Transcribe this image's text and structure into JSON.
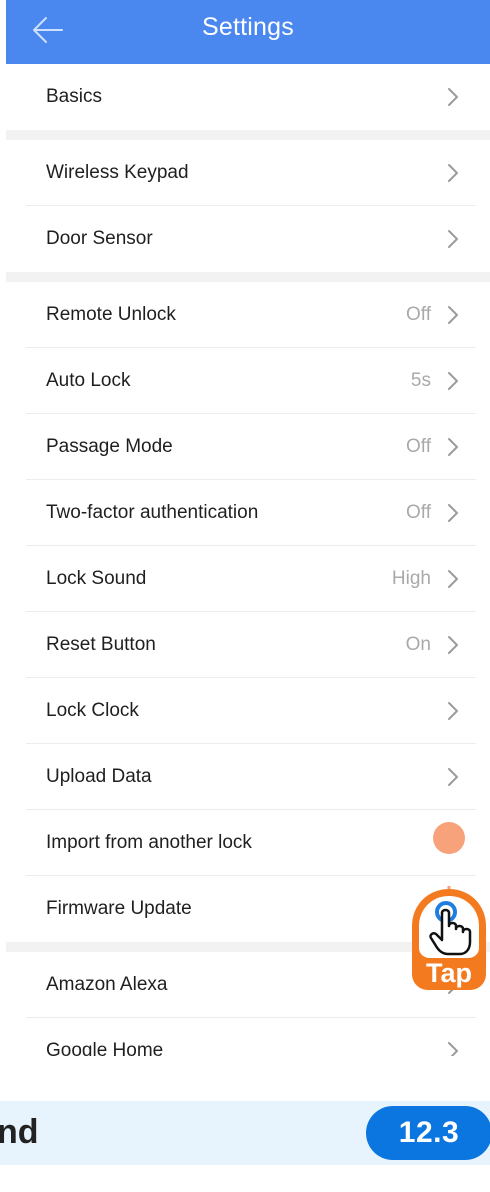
{
  "header": {
    "title": "Settings",
    "back_icon": "arrow-left-icon"
  },
  "groups": [
    [
      {
        "label": "Basics",
        "value": ""
      }
    ],
    [
      {
        "label": "Wireless Keypad",
        "value": ""
      },
      {
        "label": "Door Sensor",
        "value": ""
      }
    ],
    [
      {
        "label": "Remote Unlock",
        "value": "Off"
      },
      {
        "label": "Auto Lock",
        "value": "5s"
      },
      {
        "label": "Passage Mode",
        "value": "Off"
      },
      {
        "label": "Two-factor authentication",
        "value": "Off"
      },
      {
        "label": "Lock Sound",
        "value": "High"
      },
      {
        "label": "Reset Button",
        "value": "On"
      },
      {
        "label": "Lock Clock",
        "value": ""
      },
      {
        "label": "Upload Data",
        "value": ""
      },
      {
        "label": "Import from another lock",
        "value": ""
      },
      {
        "label": "Firmware Update",
        "value": ""
      }
    ],
    [
      {
        "label": "Amazon Alexa",
        "value": ""
      },
      {
        "label": "Google Home",
        "value": ""
      }
    ]
  ],
  "overlay": {
    "tap_label": "Tap",
    "tap_icon": "hand-tap-icon"
  },
  "footer": {
    "text": "nd",
    "badge": "12.3"
  },
  "colors": {
    "header": "#4a87ee",
    "tap": "#f47a20",
    "badge": "#0b75e0",
    "footer_bg": "#e7f4fd"
  }
}
